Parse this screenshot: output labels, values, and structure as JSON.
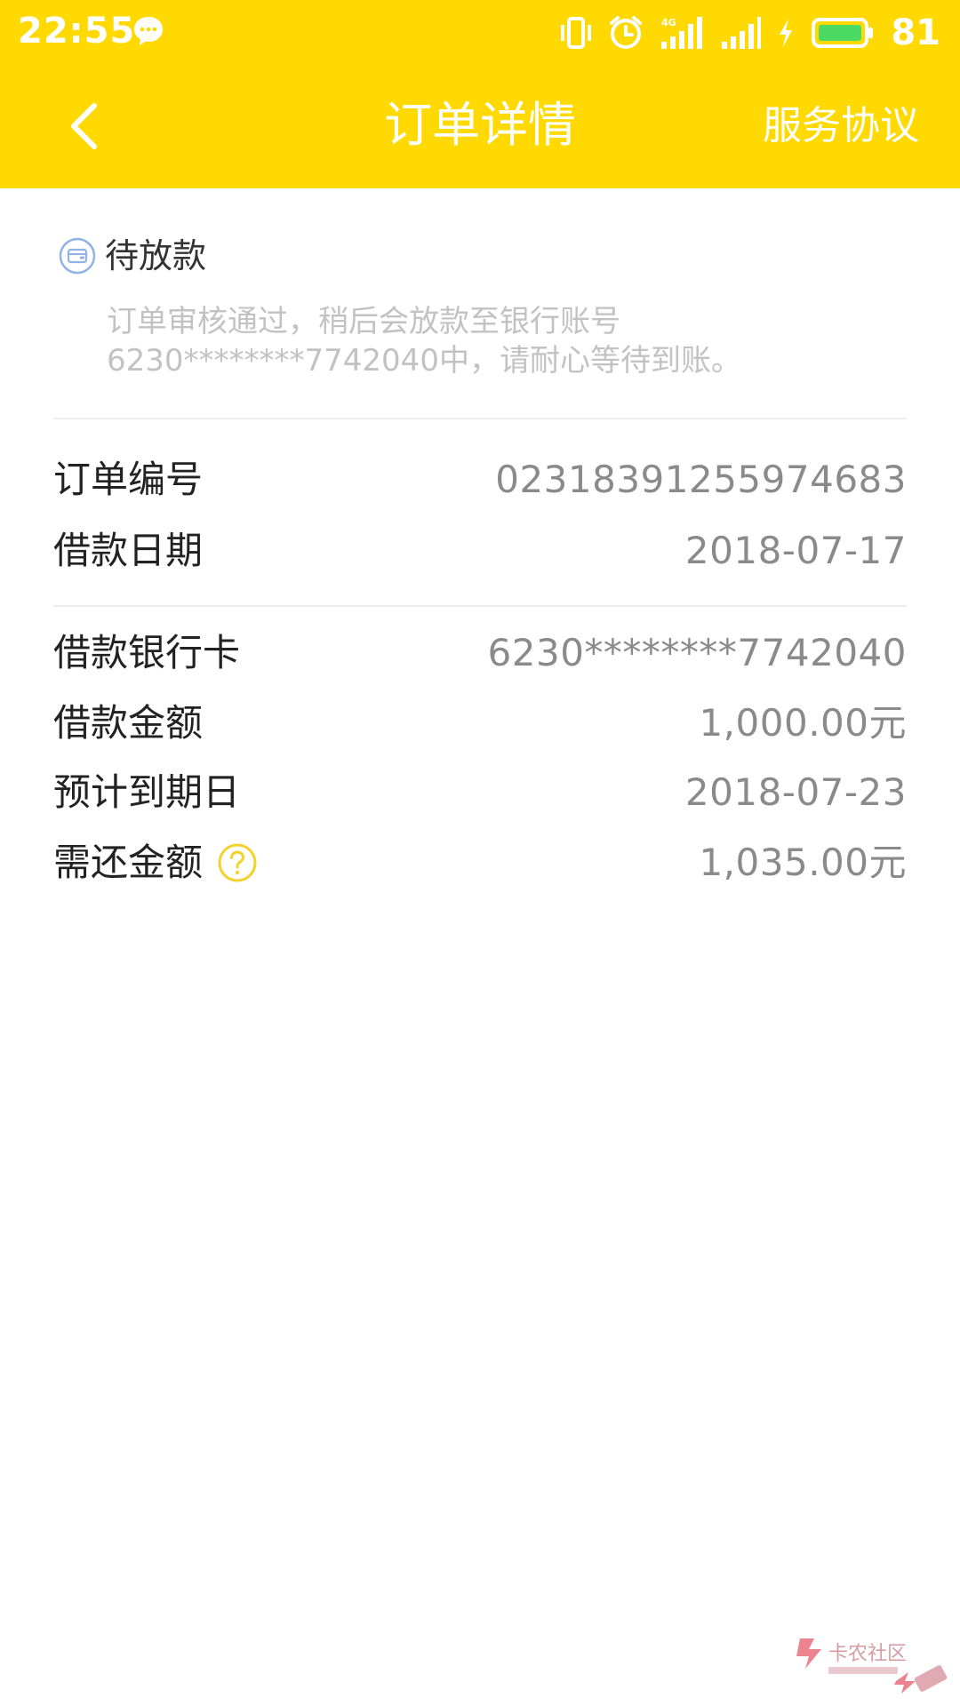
{
  "status_bar": {
    "time": "22:55",
    "network_label": "4G",
    "battery": "81"
  },
  "nav": {
    "title": "订单详情",
    "right_link": "服务协议"
  },
  "order_status": {
    "title": "待放款",
    "description": "订单审核通过，稍后会放款至银行账号6230********7742040中，请耐心等待到账。"
  },
  "order_info": [
    {
      "label": "订单编号",
      "value": "02318391255974683"
    },
    {
      "label": "借款日期",
      "value": "2018-07-17"
    }
  ],
  "loan_info": [
    {
      "label": "借款银行卡",
      "value": "6230********7742040"
    },
    {
      "label": "借款金额",
      "value": "1,000.00元"
    },
    {
      "label": "预计到期日",
      "value": "2018-07-23"
    },
    {
      "label": "需还金额",
      "value": "1,035.00元"
    }
  ],
  "watermark": {
    "text": "卡农社区"
  },
  "colors": {
    "header": "#FFD900",
    "help_icon": "#F3D22C",
    "pending_icon": "#8FB3E6"
  }
}
